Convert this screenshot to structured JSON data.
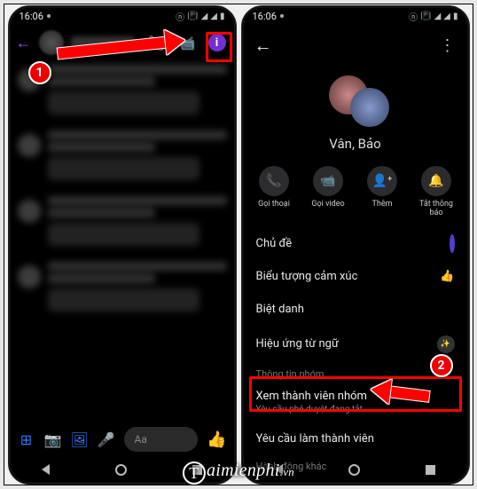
{
  "status": {
    "time": "16:06",
    "icons_right": [
      "nfc",
      "vib",
      "wifi",
      "sig1",
      "sig2",
      "batt"
    ]
  },
  "phone1": {
    "input_placeholder": "Aa",
    "info_glyph": "i"
  },
  "phone2": {
    "group_name": "Vân, Bảo",
    "actions": {
      "call": "Gọi thoại",
      "video": "Gọi video",
      "add": "Thêm",
      "mute": "Tắt thông báo"
    },
    "settings": {
      "theme": "Chủ đề",
      "emoji": "Biểu tượng cảm xúc",
      "nickname": "Biệt danh",
      "word_effect": "Hiệu ứng từ ngữ"
    },
    "sections": {
      "group_info": "Thông tin nhóm",
      "other_actions": "Hành động khác"
    },
    "members": {
      "title": "Xem thành viên nhóm",
      "subtitle": "Yêu cầu phê duyệt đang tắt"
    },
    "request": "Yêu cầu làm thành viên"
  },
  "annotations": {
    "step1": "1",
    "step2": "2"
  },
  "watermark": {
    "cap": "T",
    "rest": "aimienphi",
    "tld": ".vn"
  }
}
